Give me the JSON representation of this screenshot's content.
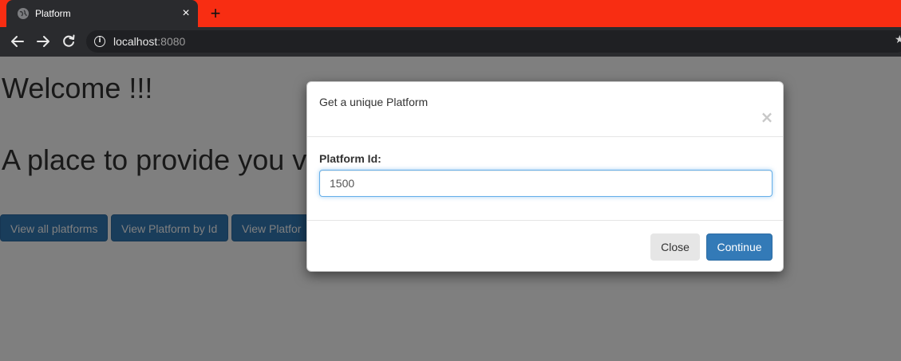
{
  "browser": {
    "tab_title": "Platform",
    "tab_close": "×",
    "new_tab": "+",
    "url_host": "localhost",
    "url_port": ":8080",
    "icons": {
      "favicon": "globe-icon",
      "back": "arrow-left-icon",
      "forward": "arrow-right-icon",
      "reload": "reload-icon",
      "info": "info-icon",
      "bookmark": "star-icon"
    }
  },
  "page": {
    "welcome": "Welcome !!!",
    "tagline": "A place to provide you v",
    "buttons": [
      "View all platforms",
      "View Platform by Id",
      "View Platfor"
    ]
  },
  "modal": {
    "title": "Get a unique Platform",
    "close_symbol": "×",
    "field_label": "Platform Id:",
    "field_value": "1500",
    "close_button": "Close",
    "continue_button": "Continue"
  },
  "colors": {
    "tabstrip_accent": "#f82d12",
    "primary": "#337ab7",
    "chrome_dark": "#2a2b2e"
  }
}
